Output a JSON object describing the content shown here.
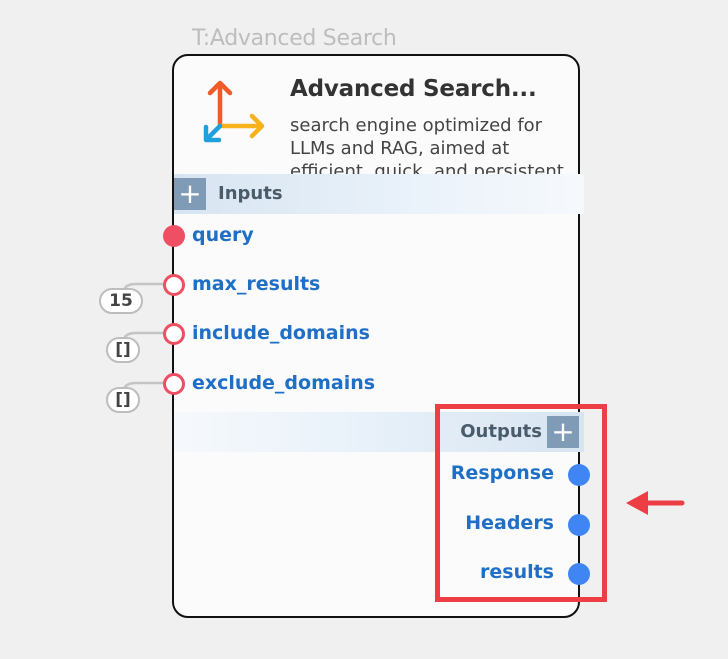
{
  "node": {
    "type_label": "T:Advanced Search",
    "title": "Advanced Search...",
    "description": "search engine optimized for LLMs and RAG, aimed at efficient, quick, and persistent search results",
    "icon": "axes-arrows-icon"
  },
  "inputs": {
    "label": "Inputs",
    "add_icon": "plus-icon",
    "ports": [
      {
        "name": "query",
        "kind": "required"
      },
      {
        "name": "max_results",
        "kind": "optional",
        "default": "15"
      },
      {
        "name": "include_domains",
        "kind": "optional",
        "default": "[]"
      },
      {
        "name": "exclude_domains",
        "kind": "optional",
        "default": "[]"
      }
    ]
  },
  "outputs": {
    "label": "Outputs",
    "add_icon": "plus-icon",
    "ports": [
      {
        "name": "Response"
      },
      {
        "name": "Headers"
      },
      {
        "name": "results"
      }
    ]
  },
  "annotation": {
    "highlight_color": "#ed3d45",
    "arrow_icon": "left-arrow-icon"
  },
  "colors": {
    "port_required": "#ee4f62",
    "port_output": "#3f86f4",
    "port_label": "#1f6fc6",
    "section_button": "#7f9bb6"
  }
}
